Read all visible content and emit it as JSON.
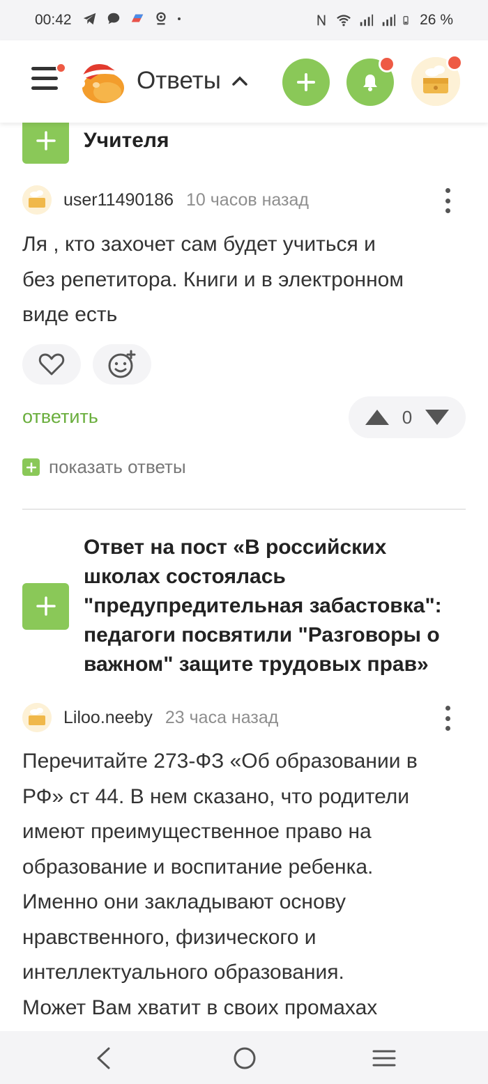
{
  "status_bar": {
    "time": "00:42",
    "battery": "26 %"
  },
  "header": {
    "title": "Ответы"
  },
  "sections": [
    {
      "title": "Учителя"
    },
    {
      "title_lines": [
        "Ответ на пост «В российских",
        "школах состоялась",
        "\"предупредительная забастовка\":",
        "педагоги посвятили \"Разговоры о",
        "важном\" защите трудовых прав»"
      ]
    }
  ],
  "comments": [
    {
      "username": "user11490186",
      "time": "10 часов назад",
      "text_lines": [
        "Ля , кто захочет сам будет учиться и",
        "без репетитора. Книги и в электронном",
        "виде есть"
      ],
      "reply_label": "ответить",
      "votes": "0",
      "show_replies_label": "показать ответы"
    },
    {
      "username": "Liloo.neeby",
      "time": "23 часа назад",
      "text_lines": [
        "Перечитайте 273-ФЗ «Об образовании в",
        "РФ» ст 44. В нем сказано, что родители",
        "имеют преимущественное право на",
        "образование и воспитание ребенка.",
        "Именно они закладывают основу",
        "нравственного, физического и",
        "интеллектуального образования.",
        "Может Вам хватит в своих промахах"
      ]
    }
  ],
  "colors": {
    "accent_green": "#8ac858",
    "link_green": "#6aae3d",
    "notification_red": "#ee5a44"
  }
}
